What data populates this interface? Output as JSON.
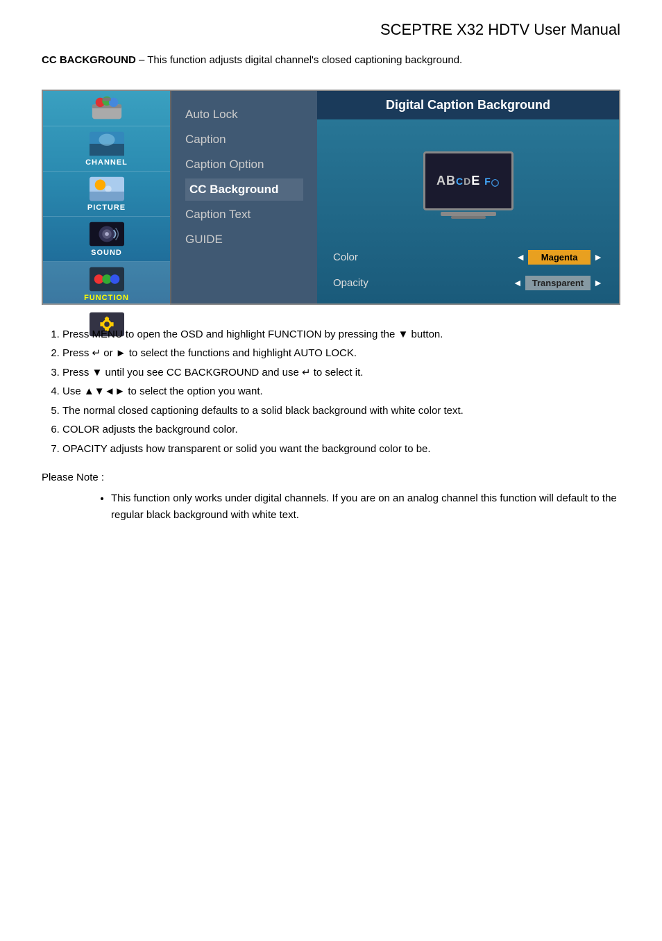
{
  "page": {
    "title": "SCEPTRE X32 HDTV User Manual"
  },
  "intro": {
    "bold": "CC BACKGROUND",
    "text": " – This function adjusts digital channel's closed captioning background."
  },
  "sidebar": {
    "items": [
      {
        "id": "toys",
        "label": ""
      },
      {
        "id": "channel",
        "label": "CHANNEL"
      },
      {
        "id": "picture",
        "label": "PICTURE"
      },
      {
        "id": "sound",
        "label": "SOUND"
      },
      {
        "id": "function",
        "label": "FUNCTION",
        "active": true
      },
      {
        "id": "setup",
        "label": "SETUP"
      }
    ]
  },
  "menu": {
    "items": [
      {
        "label": "Auto Lock",
        "state": "normal"
      },
      {
        "label": "Caption",
        "state": "normal"
      },
      {
        "label": "Caption Option",
        "state": "normal"
      },
      {
        "label": "CC Background",
        "state": "highlighted"
      },
      {
        "label": "Caption Text",
        "state": "normal"
      },
      {
        "label": "GUIDE",
        "state": "normal"
      }
    ]
  },
  "right_panel": {
    "header": "Digital Caption Background",
    "tv_text": "ABCDEF",
    "options": [
      {
        "label": "Color",
        "value": "Magenta",
        "style": "orange"
      },
      {
        "label": "Opacity",
        "value": "Transparent",
        "style": "transparent"
      }
    ]
  },
  "instructions": {
    "steps": [
      "Press MENU to open the OSD and highlight FUNCTION by pressing the ▼ button.",
      "Press ↵ or ► to select the functions and highlight AUTO LOCK.",
      "Press ▼ until you see CC BACKGROUND and use ↵ to select it.",
      "Use ▲▼◄► to select the option you want.",
      "The normal closed captioning defaults to a solid black background with white color text.",
      "COLOR adjusts the background color.",
      "OPACITY adjusts how transparent or solid you want the background color to be."
    ]
  },
  "note": {
    "label": "Please Note :",
    "bullets": [
      "This function only works under digital channels.  If you are on an analog channel this function will default to the regular black background with white text."
    ]
  }
}
